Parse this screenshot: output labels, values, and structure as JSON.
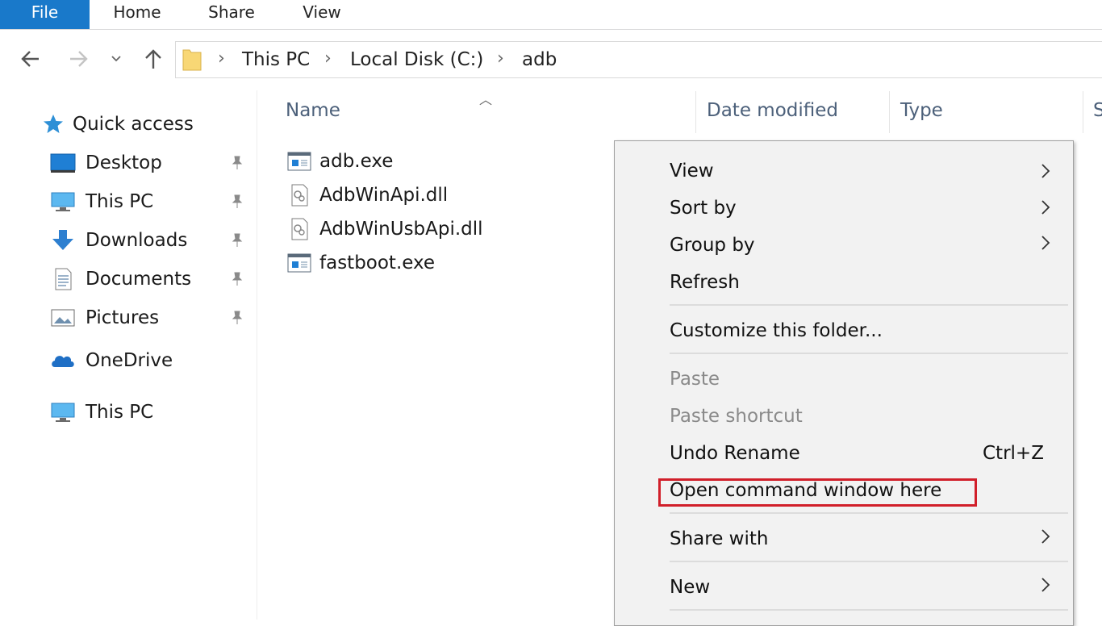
{
  "ribbon": {
    "tabs": [
      "File",
      "Home",
      "Share",
      "View"
    ],
    "active_color": "#1979ca"
  },
  "address": {
    "crumbs": [
      "This PC",
      "Local Disk (C:)",
      "adb"
    ]
  },
  "nav": {
    "quick_access": "Quick access",
    "items": [
      "Desktop",
      "This PC",
      "Downloads",
      "Documents",
      "Pictures"
    ],
    "onedrive": "OneDrive",
    "this_pc": "This PC"
  },
  "columns": {
    "name": "Name",
    "date": "Date modified",
    "type": "Type",
    "size": "S"
  },
  "files": [
    {
      "name": "adb.exe",
      "icon": "exe-icon"
    },
    {
      "name": "AdbWinApi.dll",
      "icon": "dll-icon"
    },
    {
      "name": "AdbWinUsbApi.dll",
      "icon": "dll-icon"
    },
    {
      "name": "fastboot.exe",
      "icon": "exe-icon"
    }
  ],
  "context_menu": {
    "view": "View",
    "sort_by": "Sort by",
    "group_by": "Group by",
    "refresh": "Refresh",
    "customize": "Customize this folder...",
    "paste": "Paste",
    "paste_shortcut": "Paste shortcut",
    "undo_rename": "Undo Rename",
    "undo_shortcut": "Ctrl+Z",
    "open_cmd": "Open command window here",
    "share_with": "Share with",
    "new": "New",
    "highlight_color": "#d11f2a"
  }
}
